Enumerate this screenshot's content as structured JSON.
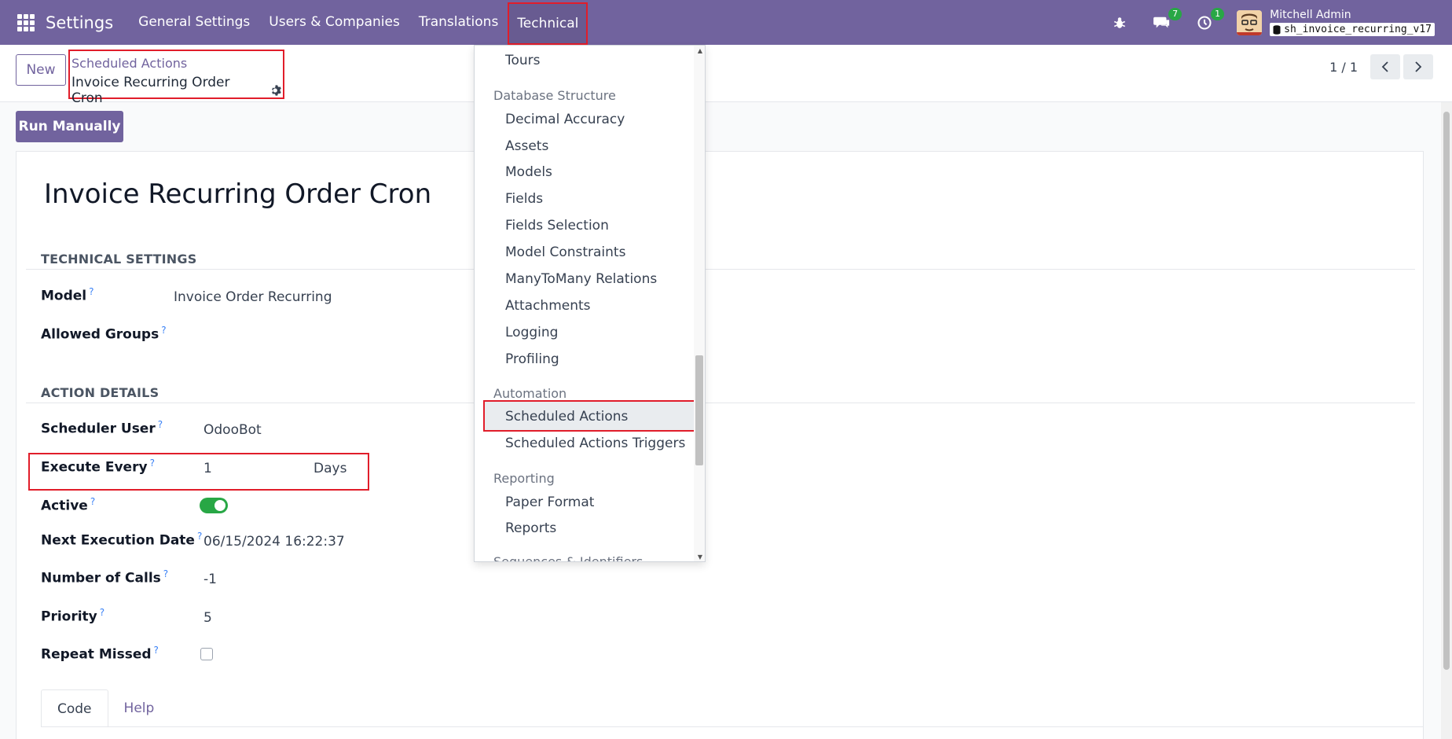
{
  "navbar": {
    "brand": "Settings",
    "menu": [
      "General Settings",
      "Users & Companies",
      "Translations",
      "Technical"
    ],
    "messages_count": "7",
    "activities_count": "1",
    "user_name": "Mitchell Admin",
    "db_name": "sh_invoice_recurring_v17"
  },
  "control": {
    "new_label": "New",
    "breadcrumb_parent": "Scheduled Actions",
    "breadcrumb_current": "Invoice Recurring Order Cron",
    "pager": "1 / 1"
  },
  "form": {
    "run_label": "Run Manually",
    "title": "Invoice Recurring Order Cron",
    "section_technical": "TECHNICAL SETTINGS",
    "section_action": "ACTION DETAILS",
    "fields": {
      "model_label": "Model",
      "model_value": "Invoice Order Recurring",
      "groups_label": "Allowed Groups",
      "user_label": "Scheduler User",
      "user_value": "OdooBot",
      "exec_label": "Execute Every",
      "exec_number": "1",
      "exec_unit": "Days",
      "active_label": "Active",
      "next_label": "Next Execution Date",
      "next_value": "06/15/2024 16:22:37",
      "calls_label": "Number of Calls",
      "calls_value": "-1",
      "priority_label": "Priority",
      "priority_value": "5",
      "repeat_label": "Repeat Missed"
    },
    "tabs": [
      "Code",
      "Help"
    ]
  },
  "dropdown": {
    "items": [
      {
        "type": "item",
        "label": "Tours"
      },
      {
        "type": "header",
        "label": "Database Structure"
      },
      {
        "type": "item",
        "label": "Decimal Accuracy"
      },
      {
        "type": "item",
        "label": "Assets"
      },
      {
        "type": "item",
        "label": "Models"
      },
      {
        "type": "item",
        "label": "Fields"
      },
      {
        "type": "item",
        "label": "Fields Selection"
      },
      {
        "type": "item",
        "label": "Model Constraints"
      },
      {
        "type": "item",
        "label": "ManyToMany Relations"
      },
      {
        "type": "item",
        "label": "Attachments"
      },
      {
        "type": "item",
        "label": "Logging"
      },
      {
        "type": "item",
        "label": "Profiling"
      },
      {
        "type": "header",
        "label": "Automation"
      },
      {
        "type": "item",
        "label": "Scheduled Actions"
      },
      {
        "type": "item",
        "label": "Scheduled Actions Triggers"
      },
      {
        "type": "header",
        "label": "Reporting"
      },
      {
        "type": "item",
        "label": "Paper Format"
      },
      {
        "type": "item",
        "label": "Reports"
      },
      {
        "type": "header",
        "label": "Sequences & Identifiers"
      }
    ]
  },
  "colors": {
    "brand": "#71639e",
    "highlight": "#e11d2a",
    "toggle_on": "#28a745"
  }
}
